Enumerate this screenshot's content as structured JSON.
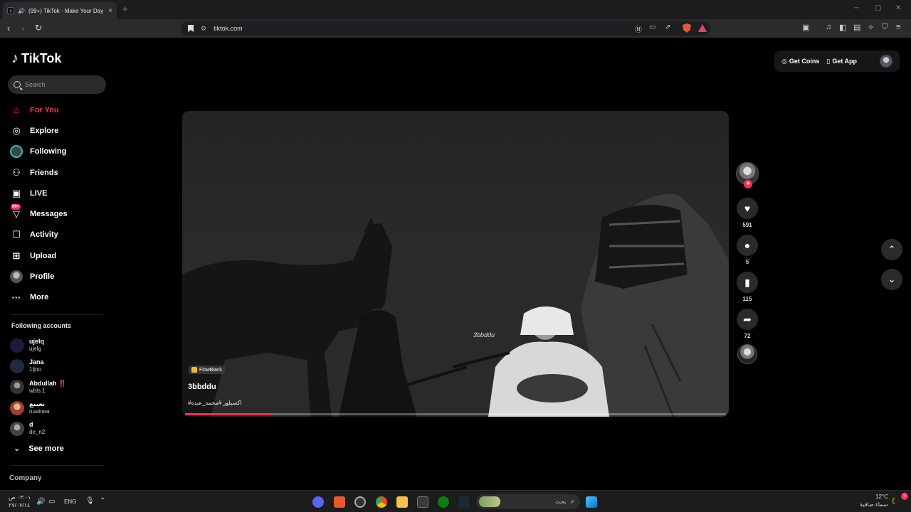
{
  "browser": {
    "tab_title": "(99+) TikTok - Make Your Day",
    "url": "tiktok.com",
    "new_tab": "+",
    "minimize": "─",
    "maximize": "▢",
    "close": "✕"
  },
  "tiktok": {
    "logo_text": "TikTok",
    "search_placeholder": "Search",
    "menu": [
      {
        "label": "For You",
        "icon": "home-icon",
        "active": true
      },
      {
        "label": "Explore",
        "icon": "compass-icon"
      },
      {
        "label": "Following",
        "icon": "following-avatar-icon"
      },
      {
        "label": "Friends",
        "icon": "friends-icon"
      },
      {
        "label": "LIVE",
        "icon": "live-icon"
      },
      {
        "label": "Messages",
        "icon": "messages-icon",
        "badge": "99+"
      },
      {
        "label": "Activity",
        "icon": "activity-icon"
      },
      {
        "label": "Upload",
        "icon": "upload-icon"
      },
      {
        "label": "Profile",
        "icon": "profile-avatar-icon"
      },
      {
        "label": "More",
        "icon": "more-icon"
      }
    ],
    "following_title": "Following accounts",
    "accounts": [
      {
        "name": "ujelq",
        "handle": "ujelg"
      },
      {
        "name": "Jana",
        "handle": "1ljno"
      },
      {
        "name": "Abdullah ‼️",
        "handle": "wbls.1"
      },
      {
        "name": "نعينع",
        "handle": "nuainea"
      },
      {
        "name": "d",
        "handle": "de_n2"
      }
    ],
    "see_more": "See more",
    "company": "Company",
    "get_coins": "Get Coins",
    "get_app": "Get App"
  },
  "video": {
    "watermark": "3bbddu",
    "music_chip": "FlowBlack",
    "author": "3bbddu",
    "caption": "#اكسبلور #محمد_عبده",
    "progress": 0.16,
    "likes": "591",
    "comments": "5",
    "saves": "115",
    "shares": "72"
  },
  "taskbar": {
    "time": "٠٣:٠١ ص",
    "date": "٢٧/٠٧/١٤",
    "lang": "ENG",
    "search_label": "بحث",
    "temp": "12°C",
    "weather": "سماء صافية",
    "notif_count": "9"
  },
  "colors": {
    "accent": "#fe2c55",
    "background": "#000000",
    "following_ring": "#25c2b8"
  }
}
